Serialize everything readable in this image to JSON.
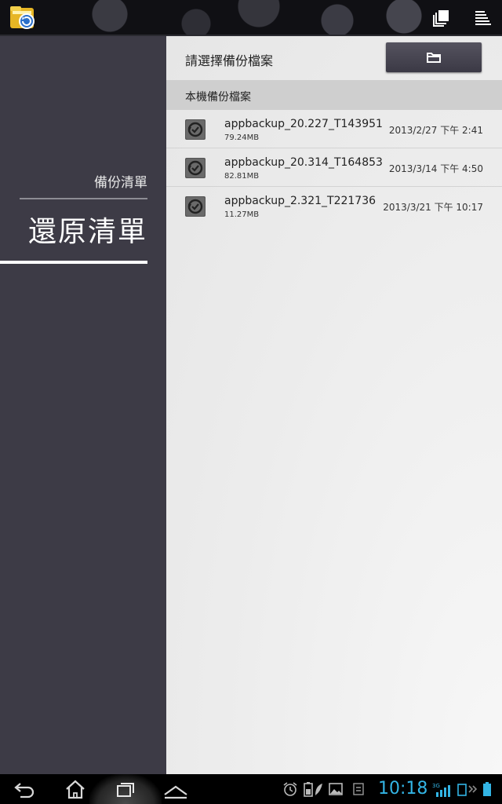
{
  "left_panel": {
    "backup_list_label": "備份清單",
    "restore_list_label": "還原清單"
  },
  "right_panel": {
    "title": "請選擇備份檔案",
    "section_header": "本機備份檔案",
    "files": [
      {
        "name": "appbackup_20.227_T143951",
        "size": "79.24MB",
        "date": "2013/2/27 下午 2:41"
      },
      {
        "name": "appbackup_20.314_T164853",
        "size": "82.81MB",
        "date": "2013/3/14 下午 4:50"
      },
      {
        "name": "appbackup_2.321_T221736",
        "size": "11.27MB",
        "date": "2013/3/21 下午 10:17"
      }
    ]
  },
  "status_bar": {
    "clock": "10:18",
    "network": "3G"
  },
  "colors": {
    "left_panel_bg": "#3d3b46",
    "accent_clock": "#33b5e5",
    "folder_button": "#4a4854"
  }
}
